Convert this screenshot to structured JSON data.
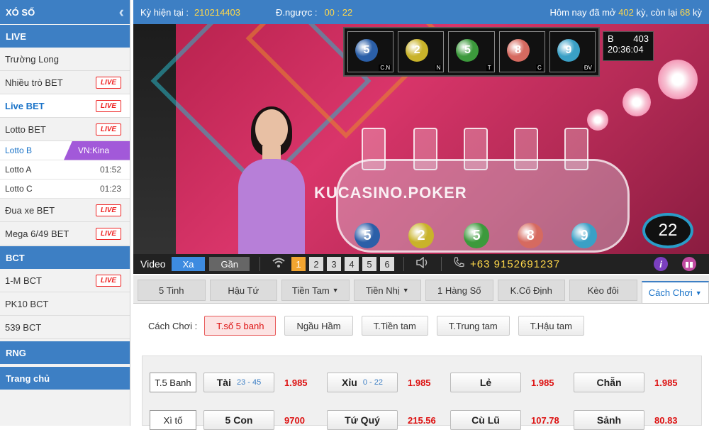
{
  "sidebar": {
    "title": "XÓ SỐ",
    "sections": {
      "live": "LIVE",
      "bct": "BCT",
      "rng": "RNG",
      "home": "Trang chủ"
    },
    "live_items": [
      {
        "label": "Trường Long"
      },
      {
        "label": "Nhiều trò BET",
        "badge": "LIVE"
      },
      {
        "label": "Live BET",
        "badge": "LIVE"
      },
      {
        "label": "Lotto BET",
        "badge": "LIVE"
      }
    ],
    "lotto": {
      "selected_label": "Lotto B",
      "selected_server": "VN:Kina",
      "a_label": "Lotto A",
      "a_time": "01:52",
      "c_label": "Lotto C",
      "c_time": "01:23"
    },
    "more_items": [
      {
        "label": "Đua xe BET",
        "badge": "LIVE"
      },
      {
        "label": "Mega 6/49 BET",
        "badge": "LIVE"
      }
    ],
    "bct_items": [
      {
        "label": "1-M BCT",
        "badge": "LIVE"
      },
      {
        "label": "PK10 BCT"
      },
      {
        "label": "539 BCT"
      }
    ]
  },
  "topbar": {
    "period_label": "Kỳ hiện tại :",
    "period_value": "210214403",
    "countdown_label": "Đ.ngược :",
    "countdown_value": "00 : 22",
    "today_prefix": "Hôm nay đã mở",
    "today_opened": "402",
    "today_mid": "kỳ, còn lại",
    "today_remaining": "68",
    "today_suffix": "kỳ"
  },
  "video": {
    "watermark": "KUCASINO.POKER",
    "round_code": "B",
    "round_no": "403",
    "clock": "20:36:04",
    "countdown": "22",
    "tv_labels": [
      "C.N",
      "N",
      "T",
      "C",
      "ĐV"
    ],
    "tv_balls": [
      "5",
      "2",
      "5",
      "8",
      "9"
    ],
    "result_balls": [
      "5",
      "2",
      "5",
      "8",
      "9"
    ],
    "ball_colors": [
      "#2b5fa8",
      "#c9b32a",
      "#3c9a3c",
      "#d66a60",
      "#3aa0c6"
    ]
  },
  "controls": {
    "video_label": "Video",
    "far": "Xa",
    "near": "Gần",
    "channels": [
      "1",
      "2",
      "3",
      "4",
      "5",
      "6"
    ],
    "phone": "+63 9152691237"
  },
  "tabs": [
    {
      "label": "5 Tinh"
    },
    {
      "label": "Hậu Tứ"
    },
    {
      "label": "Tiền Tam"
    },
    {
      "label": "Tiền Nhị"
    },
    {
      "label": "1 Hàng Số"
    },
    {
      "label": "K.Cố Định"
    },
    {
      "label": "Kèo đôi"
    },
    {
      "label": "Cách Chơi"
    }
  ],
  "play": {
    "label": "Cách Chơi :",
    "options": [
      "T.số 5 banh",
      "Ngầu Hầm",
      "T.Tiền tam",
      "T.Trung tam",
      "T.Hậu tam"
    ]
  },
  "bets": {
    "row1_label": "T.5 Banh",
    "row1": [
      {
        "name": "Tài",
        "range": "23 - 45",
        "odds": "1.985"
      },
      {
        "name": "Xỉu",
        "range": "0 - 22",
        "odds": "1.985"
      },
      {
        "name": "Lẻ",
        "range": "",
        "odds": "1.985"
      },
      {
        "name": "Chẵn",
        "range": "",
        "odds": "1.985"
      }
    ],
    "row2_label": "Xì tố",
    "row2": [
      {
        "name": "5 Con",
        "odds": "9700"
      },
      {
        "name": "Tứ Quý",
        "odds": "215.56"
      },
      {
        "name": "Cù Lũ",
        "odds": "107.78"
      },
      {
        "name": "Sảnh",
        "odds": "80.83"
      }
    ]
  }
}
